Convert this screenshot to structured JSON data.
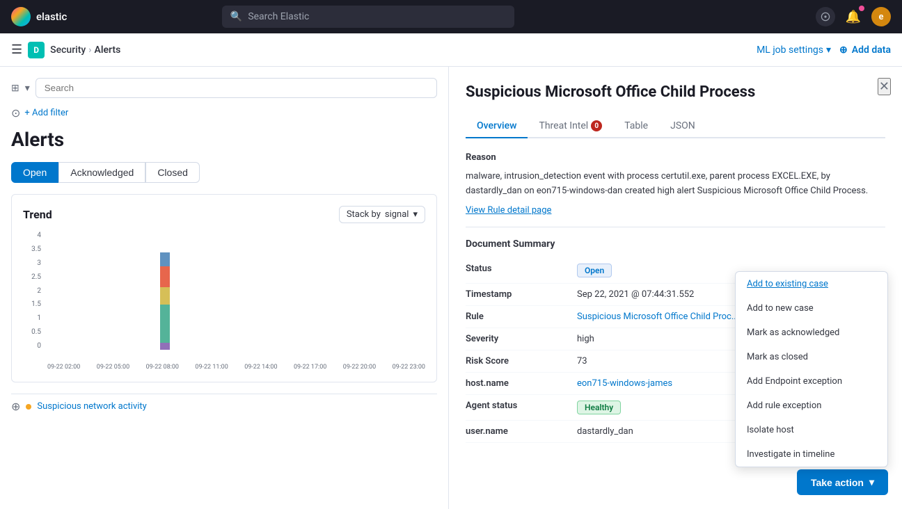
{
  "topnav": {
    "logo_text": "elastic",
    "search_placeholder": "Search Elastic",
    "user_initial": "e"
  },
  "secondnav": {
    "workspace_initial": "D",
    "breadcrumb_parent": "Security",
    "breadcrumb_current": "Alerts",
    "ml_settings": "ML job settings",
    "add_data": "Add data"
  },
  "left": {
    "search_placeholder": "Search",
    "add_filter": "+ Add filter",
    "alerts_title": "Alerts",
    "tabs": [
      "Open",
      "Acknowledged",
      "Closed"
    ],
    "active_tab": "Open",
    "trend_title": "Trend",
    "stack_by_label": "Stack by",
    "stack_by_value": "signal",
    "y_labels": [
      "4",
      "3.5",
      "3",
      "2.5",
      "2",
      "1.5",
      "1",
      "0.5",
      "0"
    ],
    "x_labels": [
      "09-22 02:00",
      "09-22 05:00",
      "09-22 08:00",
      "09-22 11:00",
      "09-22 14:00",
      "09-22 17:00",
      "09-22 20:00",
      "09-22 23:00"
    ],
    "bottom_alert_text": "Suspicious network activity",
    "bottom_alert_dot_color": "#f5a623"
  },
  "panel": {
    "title": "Suspicious Microsoft Office Child Process",
    "tabs": [
      "Overview",
      "Threat Intel",
      "Table",
      "JSON"
    ],
    "threat_intel_badge": "0",
    "active_tab": "Overview",
    "reason_label": "Reason",
    "reason_text": "malware, intrusion_detection event with process certutil.exe, parent process EXCEL.EXE, by dastardly_dan on eon715-windows-dan created high alert Suspicious Microsoft Office Child Process.",
    "view_rule_label": "View Rule detail page",
    "doc_summary_title": "Document Summary",
    "fields": [
      {
        "key": "Status",
        "value": "Open",
        "type": "status-open"
      },
      {
        "key": "Timestamp",
        "value": "Sep 22, 2021 @ 07:44:31.552",
        "type": "text"
      },
      {
        "key": "Rule",
        "value": "Suspicious Microsoft Office Child Proc...",
        "type": "link"
      },
      {
        "key": "Severity",
        "value": "high",
        "type": "text"
      },
      {
        "key": "Risk Score",
        "value": "73",
        "type": "text"
      },
      {
        "key": "host.name",
        "value": "eon715-windows-james",
        "type": "link"
      },
      {
        "key": "Agent status",
        "value": "Healthy",
        "type": "health"
      },
      {
        "key": "user.name",
        "value": "dastardly_dan",
        "type": "text"
      }
    ]
  },
  "dropdown": {
    "items": [
      {
        "label": "Add to existing case",
        "highlighted": true
      },
      {
        "label": "Add to new case",
        "highlighted": false
      },
      {
        "label": "Mark as acknowledged",
        "highlighted": false
      },
      {
        "label": "Mark as closed",
        "highlighted": false
      },
      {
        "label": "Add Endpoint exception",
        "highlighted": false
      },
      {
        "label": "Add rule exception",
        "highlighted": false
      },
      {
        "label": "Isolate host",
        "highlighted": false
      },
      {
        "label": "Investigate in timeline",
        "highlighted": false
      }
    ]
  },
  "take_action": "Take action",
  "close_icon": "✕"
}
